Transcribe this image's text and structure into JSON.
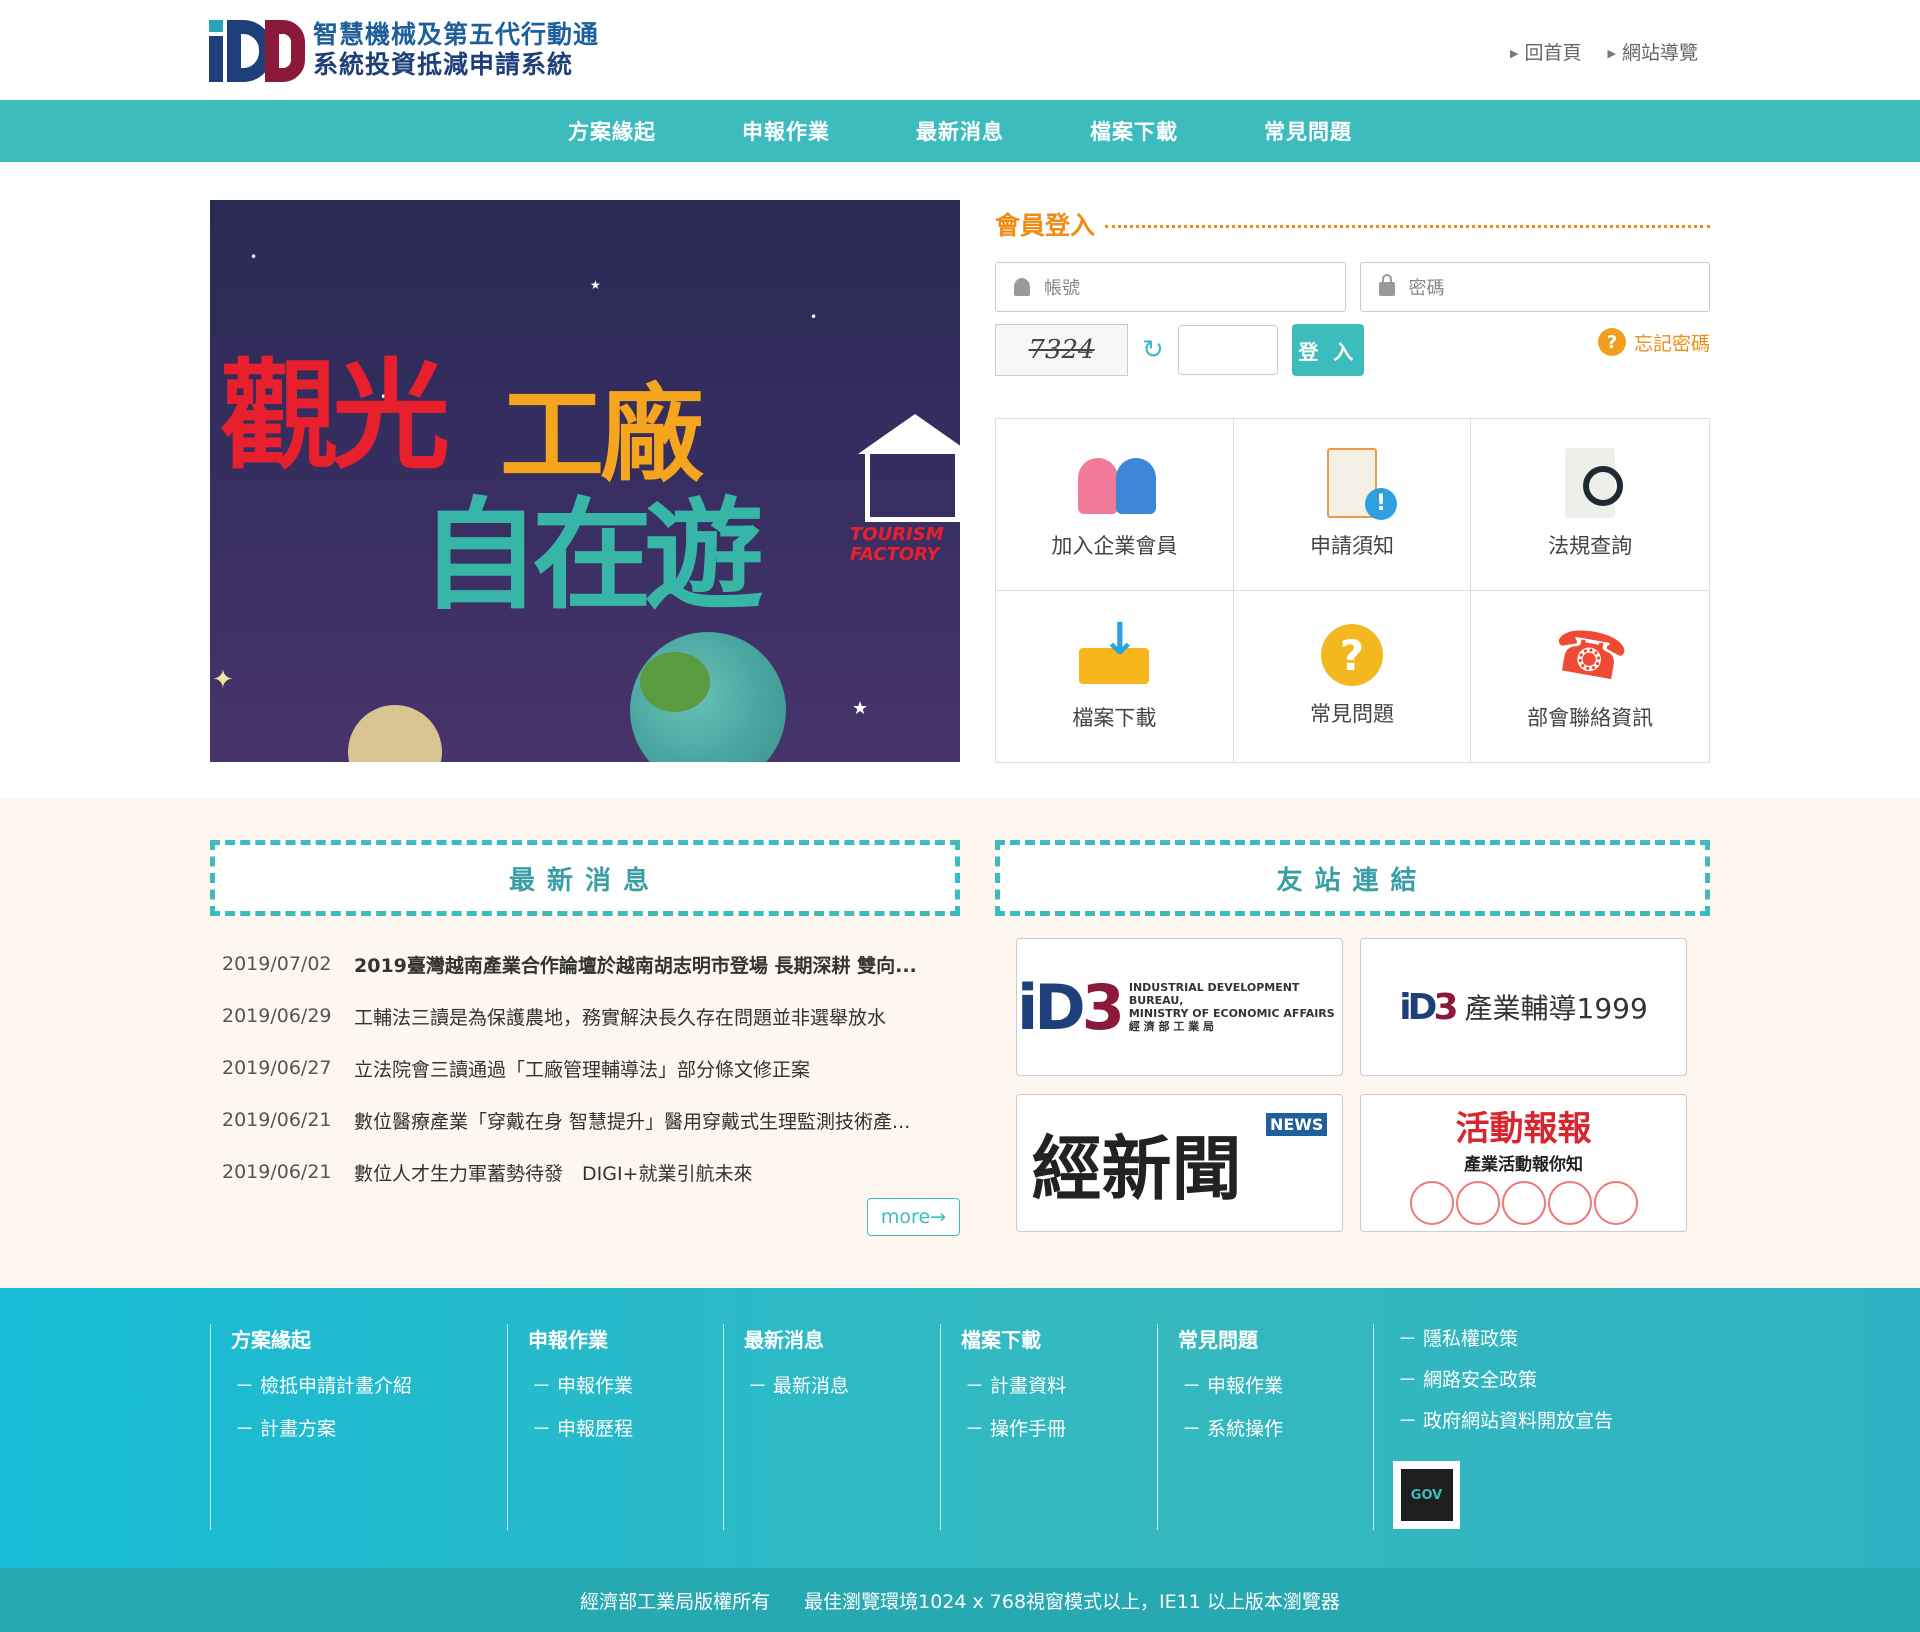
{
  "header": {
    "logo_line1": "智慧機械及第五代行動通",
    "logo_line2": "系統投資抵減申請系統",
    "links": [
      "回首頁",
      "網站導覽"
    ]
  },
  "nav": [
    "方案緣起",
    "申報作業",
    "最新消息",
    "檔案下載",
    "常見問題"
  ],
  "banner": {
    "title1": "觀光",
    "title2": "工廠",
    "title3": "自在遊",
    "tag": "TOURISM FACTORY"
  },
  "login": {
    "title": "會員登入",
    "account_placeholder": "帳號",
    "password_placeholder": "密碼",
    "captcha": "7324",
    "login_button": "登 入",
    "forgot": "忘記密碼"
  },
  "quick_links": [
    "加入企業會員",
    "申請須知",
    "法規查詢",
    "檔案下載",
    "常見問題",
    "部會聯絡資訊"
  ],
  "news": {
    "title": "最新消息",
    "items": [
      {
        "date": "2019/07/02",
        "text": "2019臺灣越南產業合作論壇於越南胡志明市登場 長期深耕 雙向..."
      },
      {
        "date": "2019/06/29",
        "text": "工輔法三讀是為保護農地，務實解決長久存在問題並非選舉放水"
      },
      {
        "date": "2019/06/27",
        "text": "立法院會三讀通過「工廠管理輔導法」部分條文修正案"
      },
      {
        "date": "2019/06/21",
        "text": "數位醫療產業「穿戴在身 智慧提升」醫用穿戴式生理監測技術產..."
      },
      {
        "date": "2019/06/21",
        "text": "數位人才生力軍蓄勢待發　DIGI+就業引航未來"
      }
    ],
    "more": "more→"
  },
  "friend_links": {
    "title": "友站連結",
    "idb_sub1": "INDUSTRIAL DEVELOPMENT BUREAU,",
    "idb_sub2": "MINISTRY OF ECONOMIC AFFAIRS",
    "idb_sub3": "經 濟 部 工 業 局",
    "hotline": "產業輔導1999",
    "news_site": "經新聞",
    "news_en": "NEWS",
    "activity_title": "活動報報",
    "activity_sub": "產業活動報你知"
  },
  "footer": {
    "cols": [
      {
        "head": "方案緣起",
        "items": [
          "檢抵申請計畫介紹",
          "計畫方案"
        ]
      },
      {
        "head": "申報作業",
        "items": [
          "申報作業",
          "申報歷程"
        ]
      },
      {
        "head": "最新消息",
        "items": [
          "最新消息"
        ]
      },
      {
        "head": "檔案下載",
        "items": [
          "計畫資料",
          "操作手冊"
        ]
      },
      {
        "head": "常見問題",
        "items": [
          "申報作業",
          "系統操作"
        ]
      }
    ],
    "policies": [
      "隱私權政策",
      "網路安全政策",
      "政府網站資料開放宣告"
    ],
    "gov_label": "GOV",
    "copyright": "經濟部工業局版權所有",
    "browser": "最佳瀏覽環境1024 x 768視窗模式以上，IE11 以上版本瀏覽器"
  }
}
